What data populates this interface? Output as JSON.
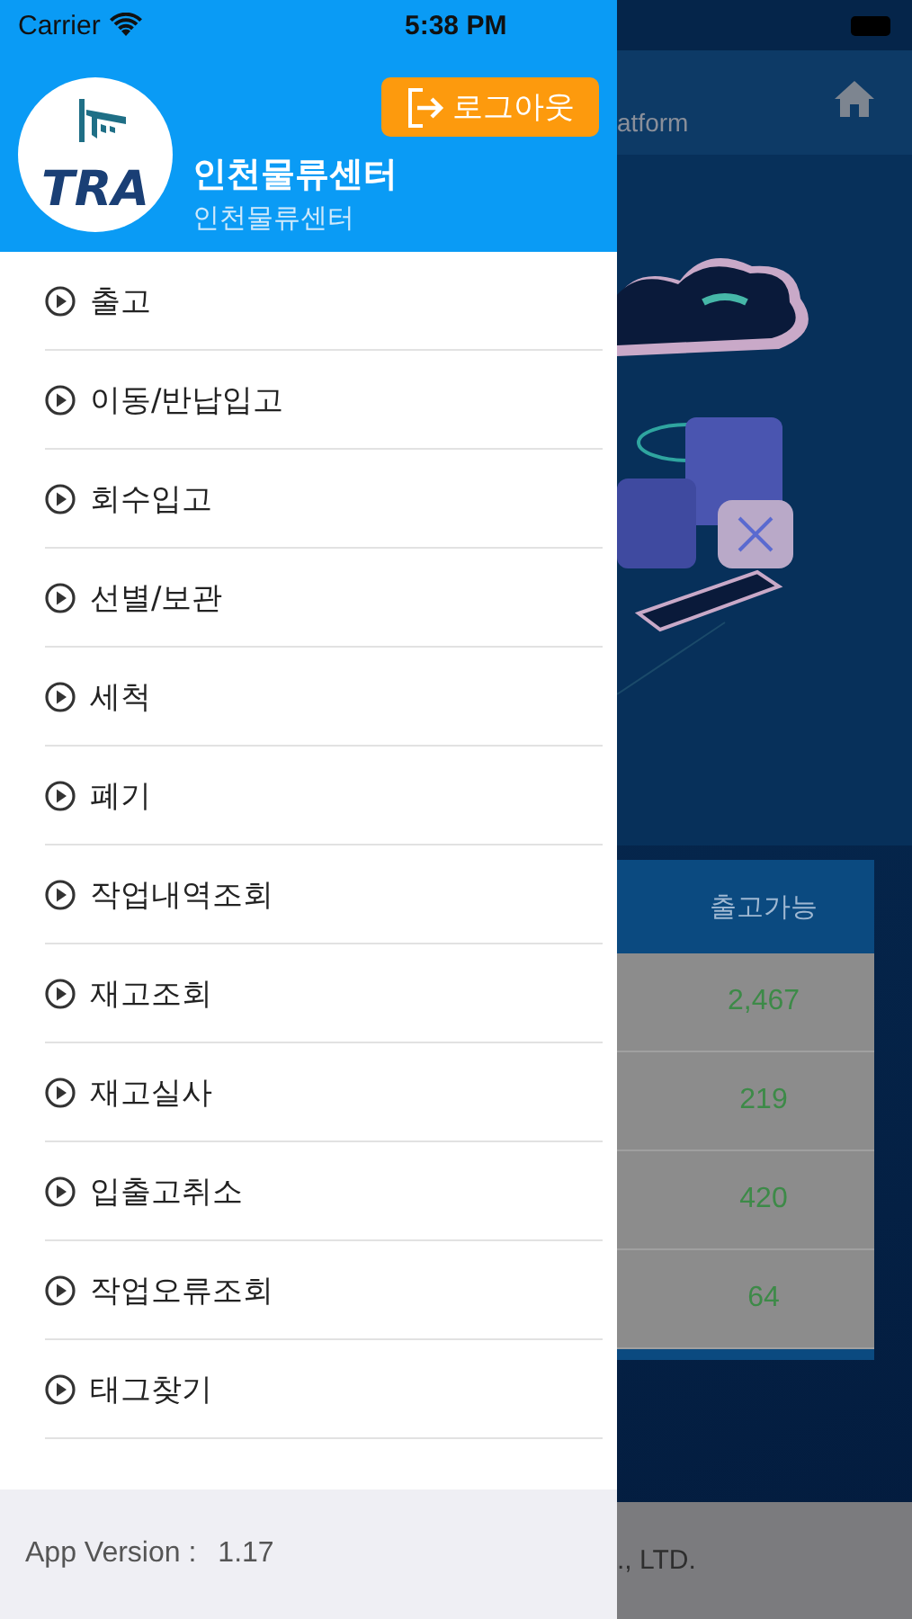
{
  "status_bar": {
    "carrier": "Carrier",
    "time": "5:38 PM"
  },
  "drawer": {
    "logo_text": "TRA",
    "logout_button": "로그아웃",
    "center_name": "인천물류센터",
    "center_subtitle": "인천물류센터",
    "menu_items": [
      {
        "label": "출고"
      },
      {
        "label": "이동/반납입고"
      },
      {
        "label": "회수입고"
      },
      {
        "label": "선별/보관"
      },
      {
        "label": "세척"
      },
      {
        "label": "폐기"
      },
      {
        "label": "작업내역조회"
      },
      {
        "label": "재고조회"
      },
      {
        "label": "재고실사"
      },
      {
        "label": "입출고취소"
      },
      {
        "label": "작업오류조회"
      },
      {
        "label": "태그찾기"
      }
    ],
    "app_version_label": "App Version :",
    "app_version": "1.17"
  },
  "background": {
    "nav_title": "atform",
    "table": {
      "column_header": "출고가능",
      "rows": [
        "2,467",
        "219",
        "420",
        "64"
      ]
    },
    "footer": "., LTD."
  }
}
